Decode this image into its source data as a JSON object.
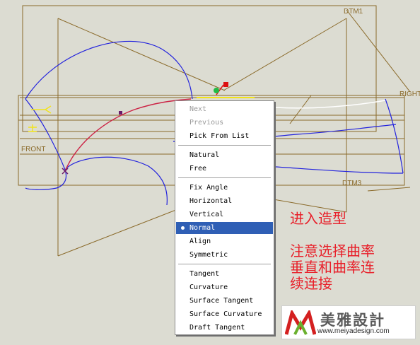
{
  "viewport": {
    "datums": [
      "DTM1",
      "FRONT",
      "DTM3",
      "RIGHT"
    ],
    "colors": {
      "background": "#dcdcd2",
      "datum": "#8a6a2a",
      "curve": "#2222dd",
      "active_curve": "#cc2244",
      "highlight": "#f2e31a"
    }
  },
  "context_menu": {
    "items_group1": [
      {
        "label": "Next",
        "enabled": false
      },
      {
        "label": "Previous",
        "enabled": false
      },
      {
        "label": "Pick From List",
        "enabled": true
      }
    ],
    "items_group2": [
      {
        "label": "Natural",
        "enabled": true
      },
      {
        "label": "Free",
        "enabled": true
      }
    ],
    "items_group3": [
      {
        "label": "Fix Angle",
        "enabled": true
      },
      {
        "label": "Horizontal",
        "enabled": true
      },
      {
        "label": "Vertical",
        "enabled": true
      },
      {
        "label": "Normal",
        "enabled": true,
        "selected": true
      },
      {
        "label": "Align",
        "enabled": true
      },
      {
        "label": "Symmetric",
        "enabled": true
      }
    ],
    "items_group4": [
      {
        "label": "Tangent",
        "enabled": true
      },
      {
        "label": "Curvature",
        "enabled": true
      },
      {
        "label": "Surface Tangent",
        "enabled": true
      },
      {
        "label": "Surface Curvature",
        "enabled": true
      },
      {
        "label": "Draft Tangent",
        "enabled": true
      }
    ],
    "selected_color": "#2f5fb5"
  },
  "annotation": {
    "lines": [
      "进入造型",
      "",
      "注意选择曲率",
      "垂直和曲率连",
      "续连接"
    ],
    "color": "#e8202a"
  },
  "watermark": {
    "name": "美雅設計",
    "url": "www.meiyadesign.com"
  }
}
